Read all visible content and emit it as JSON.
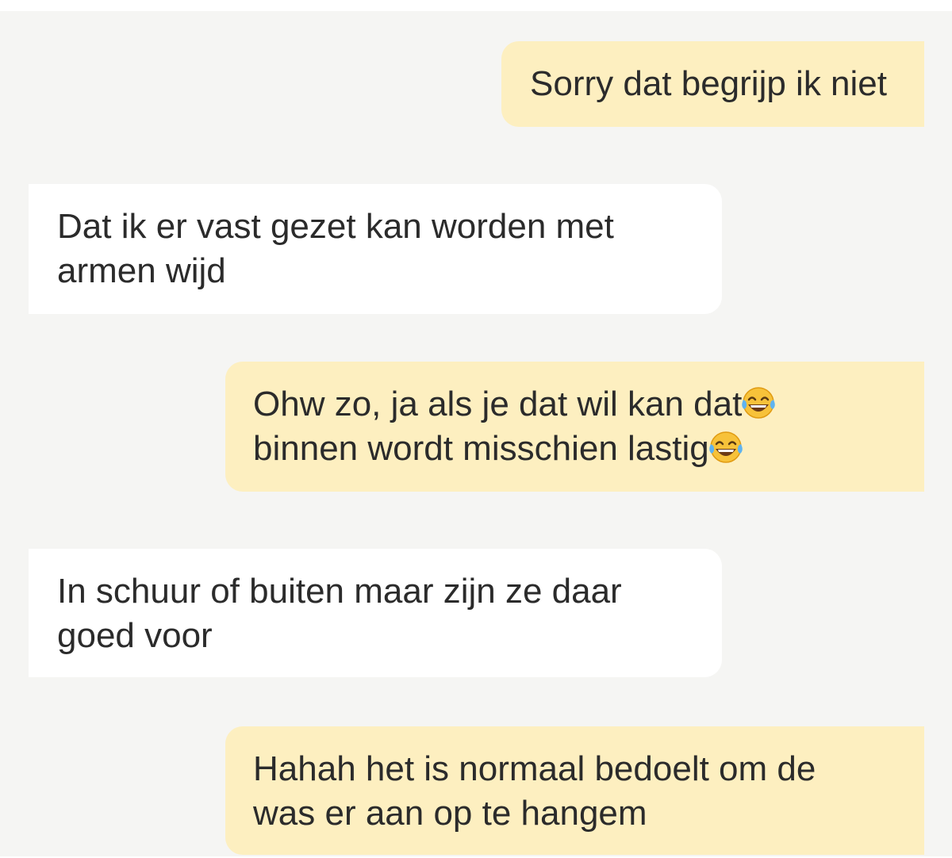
{
  "conversation": {
    "messages": [
      {
        "direction": "outgoing",
        "lines": [
          "Sorry dat begrijp ik niet"
        ]
      },
      {
        "direction": "incoming",
        "lines": [
          "Dat ik er vast gezet kan worden met",
          "armen wijd"
        ]
      },
      {
        "direction": "outgoing",
        "lines": [
          "Ohw zo, ja als je dat wil kan dat",
          "binnen wordt misschien lastig"
        ],
        "emoji": [
          "tears-of-joy-emoji",
          "tears-of-joy-emoji"
        ]
      },
      {
        "direction": "incoming",
        "lines": [
          "In schuur of buiten maar zijn ze daar",
          "goed voor"
        ]
      },
      {
        "direction": "outgoing",
        "lines": [
          "Hahah het is normaal bedoelt om de",
          "was er aan op te hangem"
        ]
      }
    ]
  },
  "colors": {
    "outgoing_bubble": "#fdefc0",
    "incoming_bubble": "#ffffff",
    "chat_background": "#f5f5f3",
    "text": "#2b2b2b"
  }
}
